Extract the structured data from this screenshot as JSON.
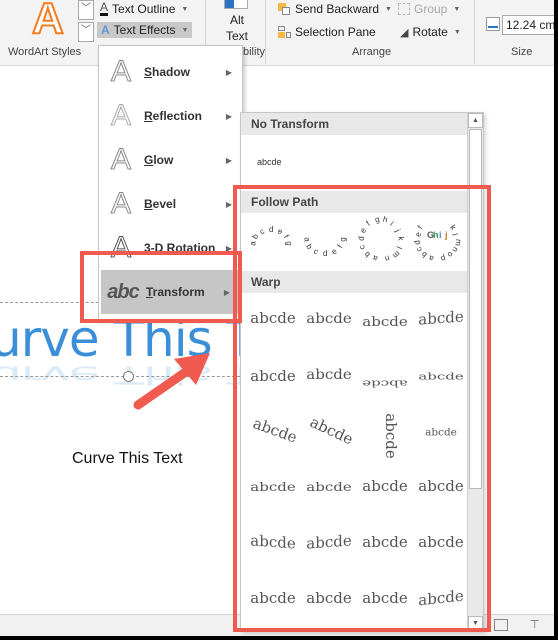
{
  "ribbon": {
    "wordart_group_label": "WordArt Styles",
    "text_outline_label": "Text Outline",
    "text_effects_label": "Text Effects",
    "alt_text_label_line1": "Alt",
    "alt_text_label_line2": "Text",
    "accessibility_group_label_partial": "bility",
    "send_backward_label": "Send Backward",
    "selection_pane_label": "Selection Pane",
    "group_label": "Group",
    "rotate_label": "Rotate",
    "arrange_group_label": "Arrange",
    "size_group_label": "Size",
    "width_value": "12.24 cm",
    "wordart_sample_glyph": "A"
  },
  "slide": {
    "title_text": "urve This Text",
    "subtitle_text": "Curve This Text"
  },
  "text_effects_menu": {
    "items": [
      {
        "label": "Shadow",
        "accel": "S",
        "rest": "hadow",
        "glyph": "A"
      },
      {
        "label": "Reflection",
        "accel": "R",
        "rest": "eflection",
        "glyph": "A"
      },
      {
        "label": "Glow",
        "accel": "G",
        "rest": "low",
        "glyph": "A"
      },
      {
        "label": "Bevel",
        "accel": "B",
        "rest": "evel",
        "glyph": "A"
      },
      {
        "label": "3-D Rotation",
        "accel": "D",
        "rest": "",
        "glyph": "A"
      },
      {
        "label": "Transform",
        "accel": "T",
        "rest": "ransform",
        "glyph": "abc",
        "active": true
      }
    ],
    "arrow_glyph": "▶"
  },
  "transform_panel": {
    "no_transform_heading": "No Transform",
    "no_transform_sample": "abcde",
    "follow_path_heading": "Follow Path",
    "follow_path_samples": [
      "abcdefg",
      "abcdefg",
      "abcdefghijklmn",
      "abcdefGhijklmnop"
    ],
    "warp_heading": "Warp",
    "warp_samples": [
      "abcde",
      "abcde",
      "abcde",
      "abcde",
      "abcde",
      "abcde",
      "abcde",
      "abcde",
      "abcde",
      "abcde",
      "abcde",
      "abcde",
      "abcde",
      "abcde",
      "abcde",
      "abcde",
      "abcde",
      "abcde",
      "abcde",
      "abcde",
      "abcde",
      "abcde",
      "abcde",
      "abcde"
    ],
    "scroll_up_glyph": "▲",
    "scroll_down_glyph": "▼"
  },
  "annotations": {
    "highlight_color": "#f05a4f"
  },
  "colors": {
    "title_blue": "#3a8fd8",
    "wordart_orange": "#f57c1f",
    "menu_active": "#c6c6c6"
  }
}
